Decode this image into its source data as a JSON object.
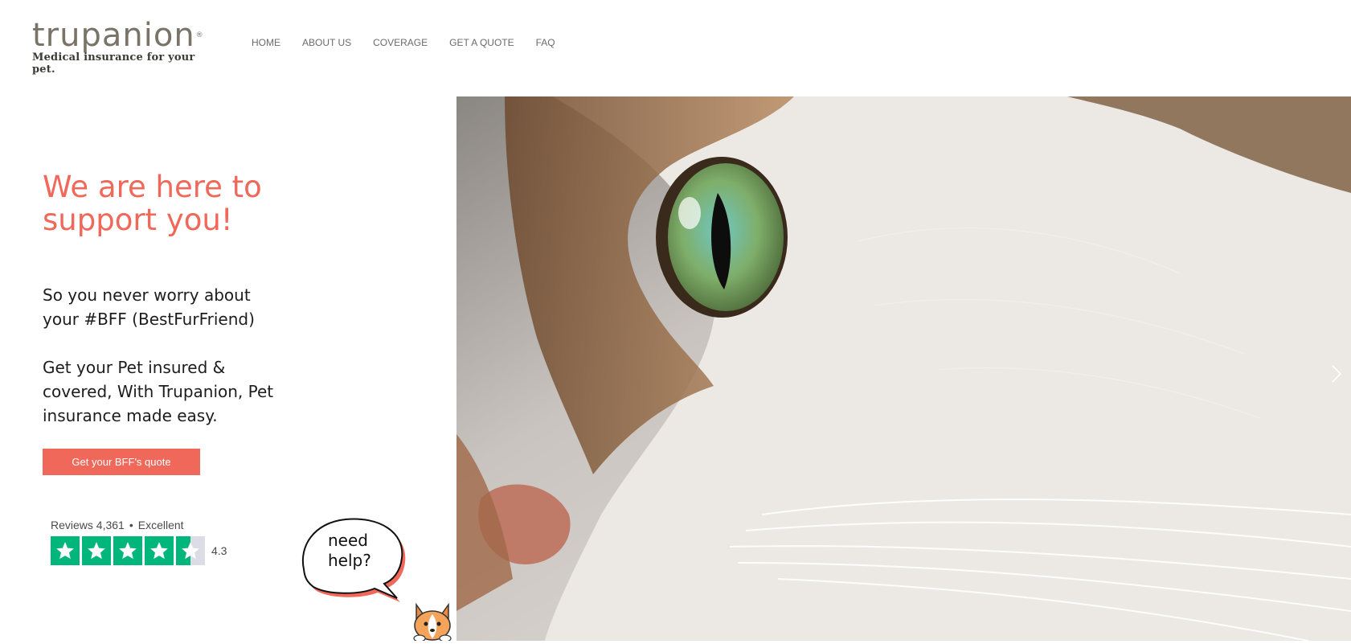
{
  "brand": {
    "name": "trupanion",
    "reg_mark": "®",
    "tagline": "Medical insurance for your pet."
  },
  "nav": {
    "items": [
      {
        "label": "HOME"
      },
      {
        "label": "ABOUT US"
      },
      {
        "label": "COVERAGE"
      },
      {
        "label": "GET A QUOTE"
      },
      {
        "label": "FAQ"
      }
    ]
  },
  "hero": {
    "title": "We are here to support you!",
    "paragraph1": "So you never worry about your #BFF (BestFurFriend)",
    "paragraph2": "Get your Pet insured & covered, With Trupanion, Pet insurance made easy.",
    "cta_label": "Get your BFF's quote"
  },
  "reviews": {
    "label": "Reviews 4,361",
    "separator": "•",
    "verdict": "Excellent",
    "rating": "4.3",
    "stars_filled": 4.5,
    "star_color": "#00b67a"
  },
  "help_widget": {
    "text": "need help?"
  },
  "colors": {
    "accent": "#f0685a",
    "logo": "#7a7367"
  },
  "icons": {
    "next": "chevron-right-icon",
    "star": "star-icon",
    "mascot": "corgi-icon"
  }
}
